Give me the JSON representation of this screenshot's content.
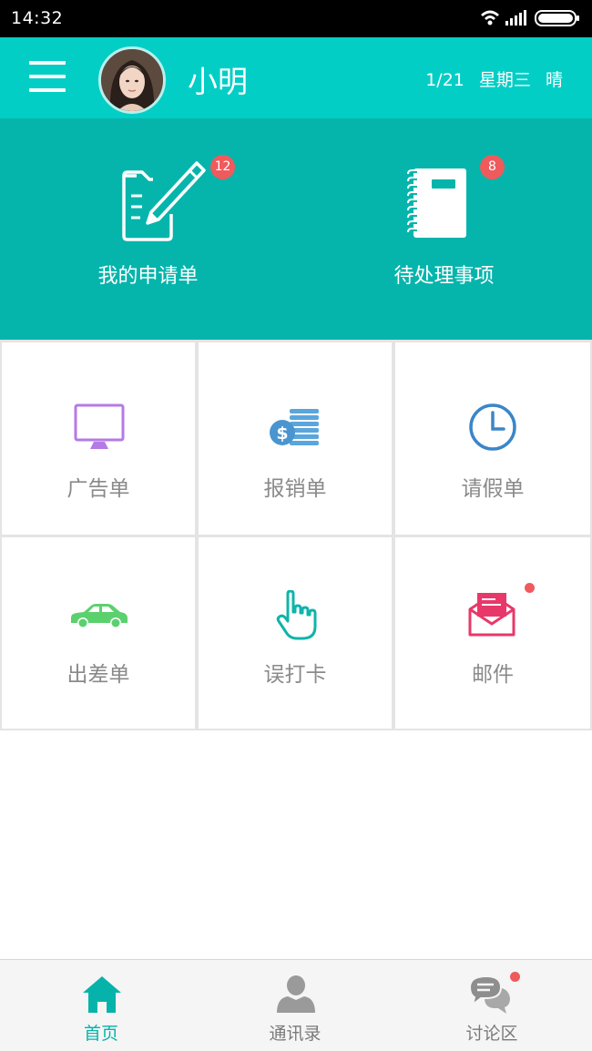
{
  "status_bar": {
    "time": "14:32",
    "icons": [
      "wifi-icon",
      "signal-icon",
      "battery-icon"
    ]
  },
  "header": {
    "menu_icon": "hamburger-menu-icon",
    "user_name": "小明",
    "date": "1/21",
    "weekday": "星期三",
    "weather": "晴"
  },
  "hero": {
    "items": [
      {
        "label": "我的申请单",
        "icon": "edit-document-icon",
        "badge": "12"
      },
      {
        "label": "待处理事项",
        "icon": "notebook-icon",
        "badge": "8"
      }
    ]
  },
  "grid": {
    "items": [
      {
        "label": "广告单",
        "icon": "monitor-icon"
      },
      {
        "label": "报销单",
        "icon": "coins-dollar-icon"
      },
      {
        "label": "请假单",
        "icon": "clock-icon"
      },
      {
        "label": "出差单",
        "icon": "car-icon"
      },
      {
        "label": "误打卡",
        "icon": "pointing-hand-icon"
      },
      {
        "label": "邮件",
        "icon": "mail-open-icon",
        "has_dot": true
      }
    ]
  },
  "bottom_nav": {
    "items": [
      {
        "label": "首页",
        "icon": "home-icon",
        "active": true
      },
      {
        "label": "通讯录",
        "icon": "contacts-person-icon"
      },
      {
        "label": "讨论区",
        "icon": "chat-bubbles-icon",
        "has_dot": true
      }
    ]
  },
  "colors": {
    "header": "#02cec6",
    "hero": "#05b5ac",
    "badge": "#ef5a5c",
    "active_nav": "#06b3aa"
  }
}
